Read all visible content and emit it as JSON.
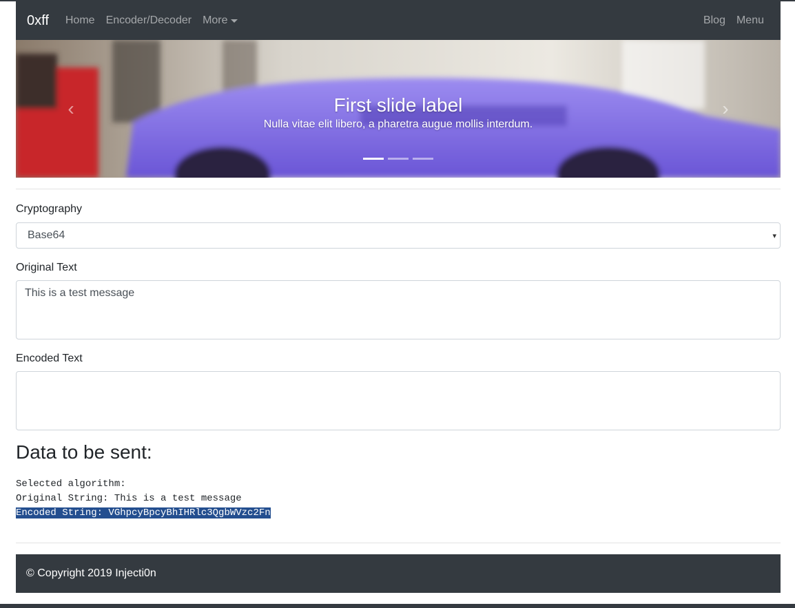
{
  "nav": {
    "brand": "0xff",
    "items": [
      "Home",
      "Encoder/Decoder",
      "More"
    ],
    "right_items": [
      "Blog",
      "Menu"
    ]
  },
  "carousel": {
    "title": "First slide label",
    "caption": "Nulla vitae elit libero, a pharetra augue mollis interdum.",
    "indicator_count": 3,
    "active_index": 0,
    "prev_icon": "chevron-left-icon",
    "next_icon": "chevron-right-icon"
  },
  "form": {
    "crypto_label": "Cryptography",
    "crypto_selected": "Base64",
    "original_label": "Original Text",
    "original_value": "This is a test message",
    "encoded_label": "Encoded Text",
    "encoded_value": ""
  },
  "output": {
    "heading": "Data to be sent:",
    "line1": "Selected algorithm:",
    "line2": "Original String: This is a test message",
    "line3": "Encoded String: VGhpcyBpcyBhIHRlc3QgbWVzc2Fn"
  },
  "footer": {
    "text": "© Copyright 2019 Injecti0n"
  },
  "colors": {
    "navbar": "#343a40",
    "selection": "#234e8f"
  }
}
